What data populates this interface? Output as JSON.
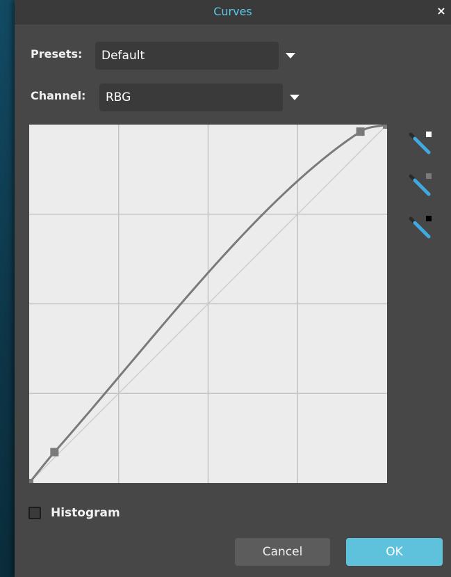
{
  "dialog": {
    "title": "Curves",
    "close_label": "×"
  },
  "presets": {
    "label": "Presets:",
    "value": "Default"
  },
  "channel": {
    "label": "Channel:",
    "value": "RBG"
  },
  "histogram": {
    "label": "Histogram",
    "checked": false
  },
  "buttons": {
    "cancel": "Cancel",
    "ok": "OK"
  },
  "curve": {
    "control_points": [
      [
        0,
        0
      ],
      [
        18,
        22
      ],
      [
        236,
        250
      ],
      [
        255,
        255
      ]
    ],
    "color": "#7a7a7a",
    "grid_divisions": 4
  },
  "eyedroppers": [
    {
      "name": "white-point",
      "swatch": "#ffffff"
    },
    {
      "name": "gray-point",
      "swatch": "#7a7a7a"
    },
    {
      "name": "black-point",
      "swatch": "#000000"
    }
  ],
  "colors": {
    "accent": "#5fc2dc",
    "title": "#5cc6e6"
  }
}
